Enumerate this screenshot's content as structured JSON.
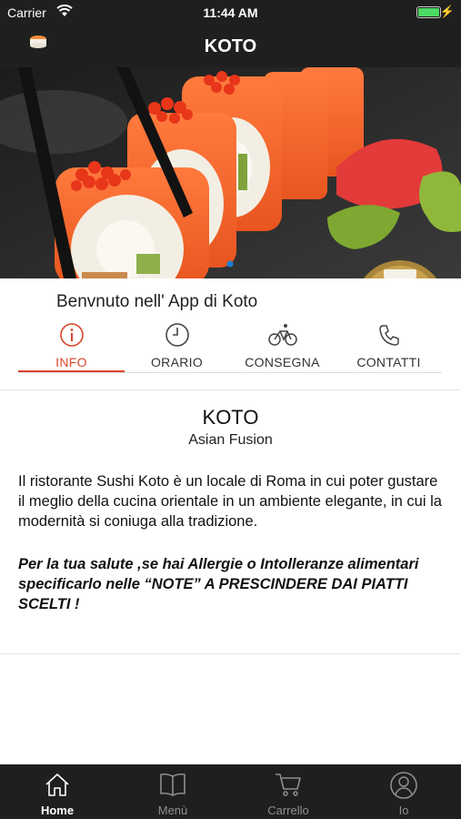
{
  "status_bar": {
    "carrier": "Carrier",
    "time": "11:44 AM"
  },
  "nav": {
    "title": "KOTO"
  },
  "welcome": "Benvnuto nell' App di Koto",
  "tabs": [
    {
      "label": "INFO",
      "icon": "info-icon",
      "active": true
    },
    {
      "label": "ORARIO",
      "icon": "clock-icon",
      "active": false
    },
    {
      "label": "CONSEGNA",
      "icon": "bicycle-icon",
      "active": false
    },
    {
      "label": "CONTATTI",
      "icon": "phone-icon",
      "active": false
    }
  ],
  "content": {
    "title": "KOTO",
    "subtitle": "Asian Fusion",
    "description": "Il ristorante Sushi Koto è un locale di Roma in cui poter gustare il meglio della cucina orientale in un ambiente elegante, in cui la modernità si coniuga alla tradizione.",
    "warning": "Per la tua salute ,se hai Allergie o Intolleranze alimentari specificarlo nelle “NOTE” A PRESCINDERE DAI PIATTI SCELTI !"
  },
  "tabbar": [
    {
      "label": "Home",
      "icon": "home-icon",
      "active": true
    },
    {
      "label": "Menù",
      "icon": "book-icon",
      "active": false
    },
    {
      "label": "Carrello",
      "icon": "cart-icon",
      "active": false
    },
    {
      "label": "Io",
      "icon": "user-icon",
      "active": false
    }
  ],
  "colors": {
    "accent": "#d9452b",
    "bar_background": "#1f1f1f",
    "battery": "#4cd964"
  }
}
